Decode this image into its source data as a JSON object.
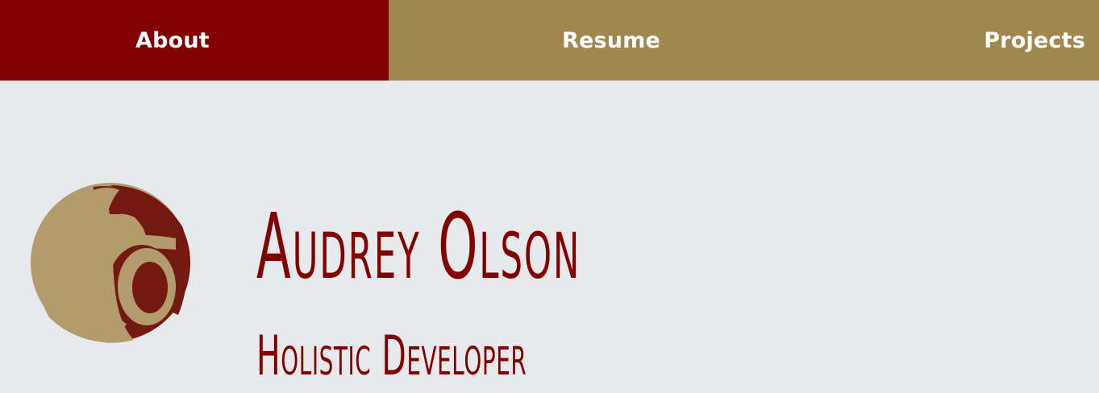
{
  "nav": {
    "items": [
      {
        "label": "About"
      },
      {
        "label": "Resume"
      },
      {
        "label": "Projects"
      }
    ]
  },
  "profile": {
    "name": "Audrey Olson",
    "tagline": "Holistic Developer"
  },
  "colors": {
    "accent": "#820000",
    "gold": "#a0874f",
    "logo_tan": "#b39b6d",
    "logo_red": "#731910",
    "background": "#e7eaed"
  },
  "icons": {
    "logo": "ao-monogram-logo"
  }
}
